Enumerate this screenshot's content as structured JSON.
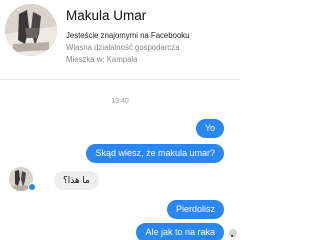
{
  "profile": {
    "name": "Makula Umar",
    "friends_line": "Jesteście znajomymi na Facebooku",
    "business_line": "Własna działalność gospodarcza",
    "lives_line": "Mieszka w: Kampala"
  },
  "chat": {
    "timestamp": "13:40",
    "messages": [
      {
        "direction": "out",
        "text": "Yo"
      },
      {
        "direction": "out",
        "text": "Skąd wiesz, że makula umar?"
      },
      {
        "direction": "in",
        "text": "ما هذا؟"
      },
      {
        "direction": "out",
        "text": "Pierdolisz"
      },
      {
        "direction": "out",
        "text": "Ale jak to na raka"
      }
    ]
  },
  "colors": {
    "outgoing_bubble": "#2a86f0",
    "incoming_bubble": "#eeeeee"
  }
}
